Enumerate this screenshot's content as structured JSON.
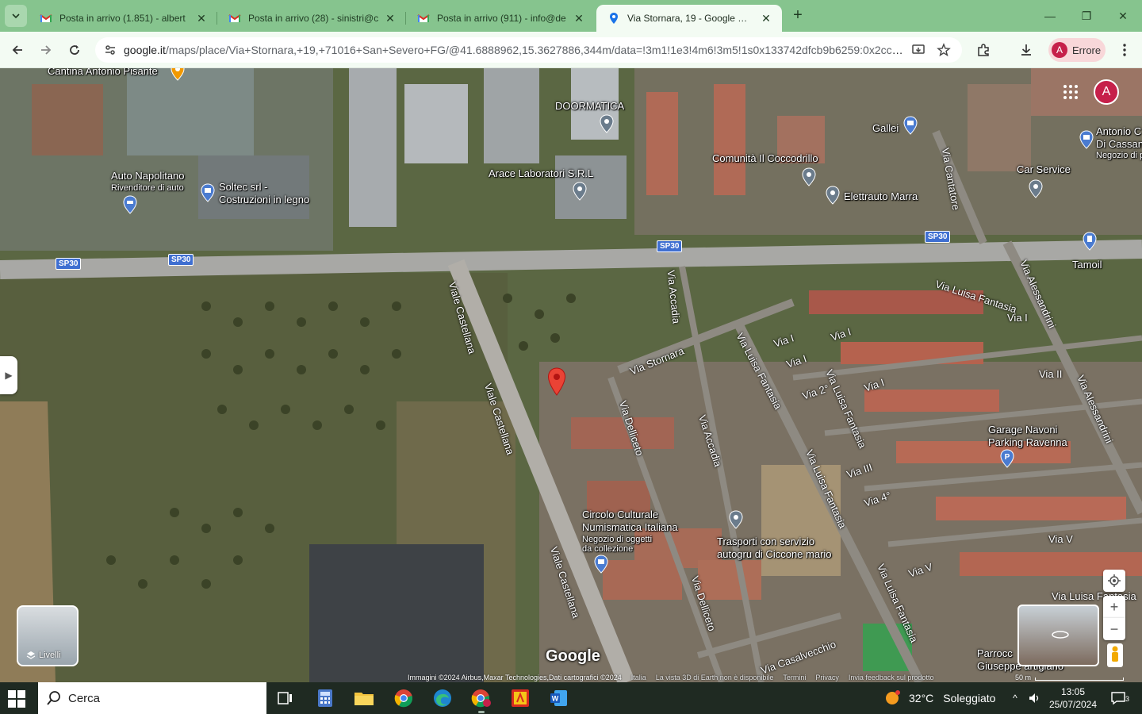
{
  "browser": {
    "tabs": [
      {
        "title": "Posta in arrivo (1.851) - albert",
        "icon": "gmail-icon"
      },
      {
        "title": "Posta in arrivo (28) - sinistri@c",
        "icon": "gmail-icon"
      },
      {
        "title": "Posta in arrivo (911) - info@de",
        "icon": "gmail-icon"
      },
      {
        "title": "Via Stornara, 19 - Google Maps",
        "icon": "maps-pin-icon",
        "active": true
      }
    ],
    "url_host": "google.it",
    "url_path": "/maps/place/Via+Stornara,+19,+71016+San+Severo+FG/@41.6888962,15.3627886,344m/data=!3m1!1e3!4m6!3m5!1s0x133742dfcb9b6259:0x2cc3d...",
    "profile_label": "Errore",
    "profile_initial": "A",
    "accent_color": "#86c48e"
  },
  "map": {
    "user_initial": "A",
    "google_logo": "Google",
    "layers_label": "Livelli",
    "scale_label": "50 m",
    "attribution": {
      "imagery": "Immagini ©2024 Airbus,Maxar Technologies,Dati cartografici ©2024",
      "country": "Italia",
      "view_3d": "La vista 3D di Earth non è disponibile",
      "terms": "Termini",
      "privacy": "Privacy",
      "feedback": "Invia feedback sul prodotto"
    },
    "road_shields": [
      "SP30",
      "SP30",
      "SP30",
      "SP30"
    ],
    "roads": [
      "Viale Castellana",
      "Viale Castellana",
      "Viale Castellana",
      "Via Stornara",
      "Via Accadia",
      "Via Accadia",
      "Via Delliceto",
      "Via Delliceto",
      "Via Luisa Fantasia",
      "Via Luisa Fantasia",
      "Via Luisa Fantasia",
      "Via Luisa Fantasia",
      "Via Luisa Fantasia",
      "Via Luisa Fantasia",
      "Via Alessandrini",
      "Via Alessandrini",
      "Via Cantatore",
      "Via Casalvecchio",
      "Via I",
      "Via I",
      "Via I",
      "Via I",
      "Via I",
      "Via II",
      "Via 2°",
      "Via III",
      "Via 4°",
      "Via V",
      "Via V",
      "Via Luisa Fantasia"
    ],
    "places": {
      "cantina": "Cantina Antonio Pisante",
      "doormatica": "DOORMATICA",
      "auto_napolitano": "Auto Napolitano",
      "auto_napolitano_sub": "Rivenditore di auto",
      "soltec_1": "Soltec srl -",
      "soltec_2": "Costruzioni in legno",
      "arace": "Arace Laboratori S.R.L",
      "comunita": "Comunità Il Coccodrillo",
      "galle": "Gallei",
      "elettrauto": "Elettrauto Marra",
      "antonio_1": "Antonio C",
      "antonio_2": "Di Cassan",
      "antonio_3": "Negozio di p",
      "car_service": "Car Service",
      "tamoil": "Tamoil",
      "garage_1": "Garage Navoni",
      "garage_2": "Parking Ravenna",
      "circolo_1": "Circolo Culturale",
      "circolo_2": "Numismatica Italiana",
      "circolo_3": "Negozio di oggetti",
      "circolo_4": "da collezione",
      "trasporti_1": "Trasporti con servizio",
      "trasporti_2": "autogru di Ciccone mario",
      "parrocchia_1": "Parrocc",
      "parrocchia_2": "Giuseppe artigiano"
    }
  },
  "taskbar": {
    "search_label": "Cerca",
    "weather_temp": "32°C",
    "weather_text": "Soleggiato",
    "time": "13:05",
    "date": "25/07/2024",
    "notifications": "3",
    "apps": [
      "task-view",
      "calculator",
      "file-explorer",
      "chrome",
      "edge",
      "chrome-profile",
      "acrobat",
      "word"
    ]
  }
}
